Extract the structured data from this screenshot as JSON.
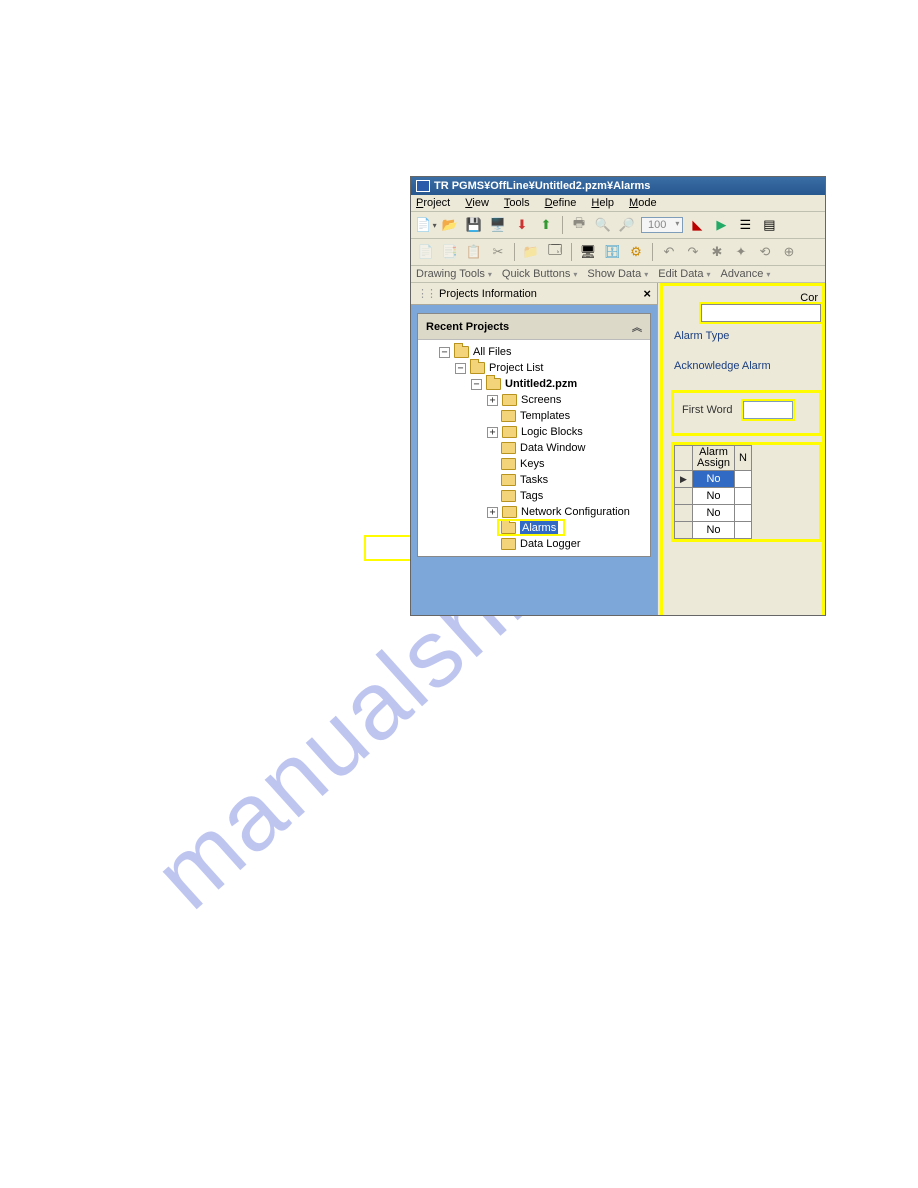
{
  "titlebar": "TR PGMS¥OffLine¥Untitled2.pzm¥Alarms",
  "menu": {
    "project": "Project",
    "view": "View",
    "tools": "Tools",
    "define": "Define",
    "help": "Help",
    "mode": "Mode"
  },
  "zoom": "100",
  "toolbar_dd": {
    "drawing": "Drawing Tools",
    "quick": "Quick Buttons",
    "show": "Show Data",
    "edit": "Edit Data",
    "advance": "Advance"
  },
  "panel_title": "Projects Information",
  "recent_title": "Recent Projects",
  "tree": {
    "all_files": "All Files",
    "project_list": "Project List",
    "untitled": "Untitled2.pzm",
    "screens": "Screens",
    "templates": "Templates",
    "logic": "Logic Blocks",
    "dataw": "Data Window",
    "keys": "Keys",
    "tasks": "Tasks",
    "tags": "Tags",
    "netconf": "Network Configuration",
    "alarms": "Alarms",
    "datalogger": "Data Logger"
  },
  "right": {
    "cor": "Cor",
    "alarm_type": "Alarm Type",
    "ack": "Acknowledge Alarm",
    "first_word": "First Word",
    "col_assign_l1": "Alarm",
    "col_assign_l2": "Assign",
    "col_n": "N",
    "vals": [
      "No",
      "No",
      "No",
      "No"
    ]
  },
  "watermark": "manualshive.com"
}
